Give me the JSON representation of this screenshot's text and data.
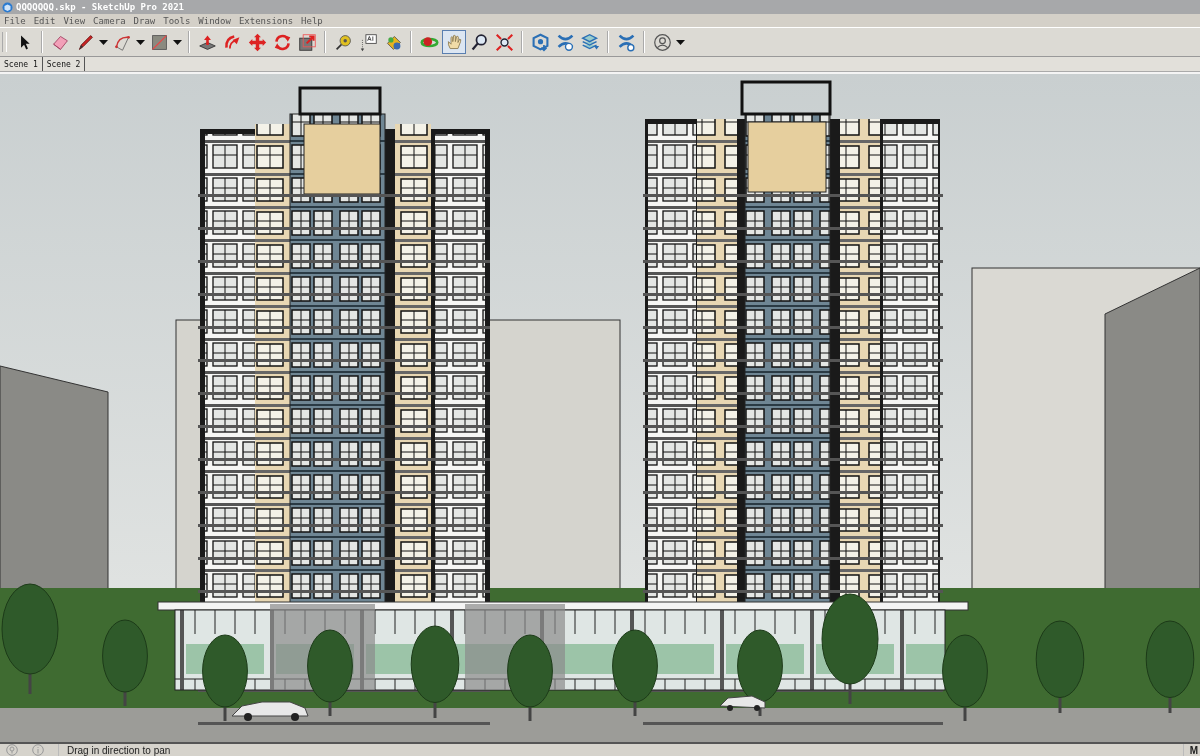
{
  "window": {
    "title": "QQQQQQQ.skp - SketchUp Pro 2021"
  },
  "menu": [
    "File",
    "Edit",
    "View",
    "Camera",
    "Draw",
    "Tools",
    "Window",
    "Extensions",
    "Help"
  ],
  "toolbar": {
    "groups": [
      [
        {
          "kind": "select",
          "selected": false
        }
      ],
      [
        {
          "kind": "eraser",
          "selected": false
        },
        {
          "kind": "pencil",
          "selected": false
        },
        {
          "kind": "dropdown",
          "selected": false
        },
        {
          "kind": "arc",
          "selected": false
        },
        {
          "kind": "dropdown",
          "selected": false
        },
        {
          "kind": "rectangle",
          "selected": false
        },
        {
          "kind": "dropdown",
          "selected": false
        }
      ],
      [
        {
          "kind": "pushpull",
          "selected": false
        },
        {
          "kind": "followme",
          "selected": false
        },
        {
          "kind": "move",
          "selected": false
        },
        {
          "kind": "rotate",
          "selected": false
        },
        {
          "kind": "scale",
          "selected": false
        }
      ],
      [
        {
          "kind": "tape",
          "selected": false
        },
        {
          "kind": "text",
          "selected": false
        },
        {
          "kind": "paint",
          "selected": false
        }
      ],
      [
        {
          "kind": "orbit",
          "selected": false
        },
        {
          "kind": "pan",
          "selected": true
        },
        {
          "kind": "zoom",
          "selected": false
        },
        {
          "kind": "extents",
          "selected": false
        }
      ],
      [
        {
          "kind": "warehouse",
          "selected": false
        },
        {
          "kind": "share",
          "selected": false
        },
        {
          "kind": "layers",
          "selected": false
        }
      ],
      [
        {
          "kind": "extension",
          "selected": false
        }
      ],
      [
        {
          "kind": "account",
          "selected": false
        },
        {
          "kind": "dropdown",
          "selected": false
        }
      ]
    ]
  },
  "scenes": [
    {
      "label": "Scene 1",
      "selected": false
    },
    {
      "label": "Scene 2",
      "selected": false
    }
  ],
  "status_bar": {
    "message": "Drag in direction to pan",
    "measurements_label": "M"
  }
}
